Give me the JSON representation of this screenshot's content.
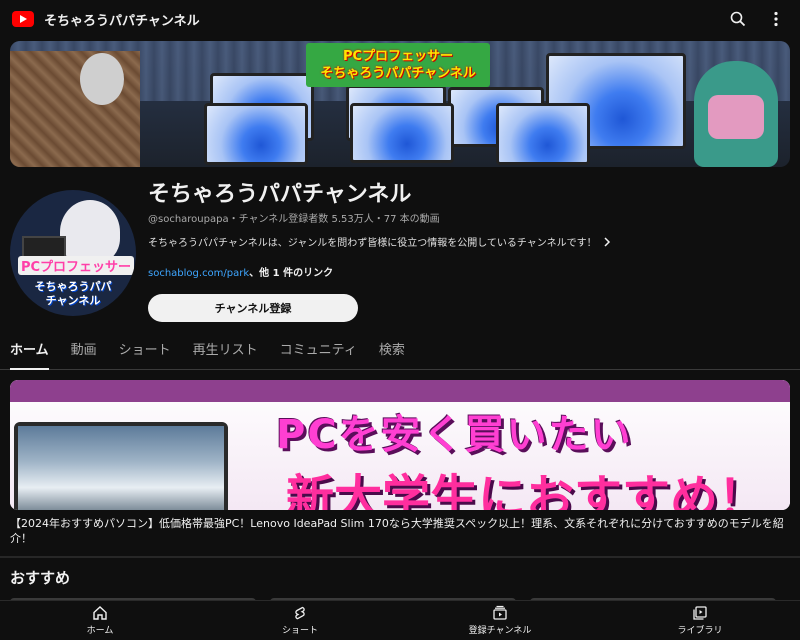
{
  "topbar": {
    "title": "そちゃろうパパチャンネル"
  },
  "banner": {
    "sign_line1": "PCプロフェッサー",
    "sign_line2": "そちゃろうパパチャンネル"
  },
  "avatar": {
    "line1": "PCプロフェッサー",
    "line2": "そちゃろうパパ",
    "line3": "チャンネル"
  },
  "channel": {
    "name": "そちゃろうパパチャンネル",
    "meta": "@socharoupapa・チャンネル登録者数 5.53万人・77 本の動画",
    "description": "そちゃろうパパチャンネルは、ジャンルを問わず皆様に役立つ情報を公開しているチャンネルです！",
    "link": "sochablog.com/park",
    "link_more": "、他 1 件のリンク",
    "subscribe_label": "チャンネル登録"
  },
  "tabs": [
    {
      "label": "ホーム",
      "active": true
    },
    {
      "label": "動画"
    },
    {
      "label": "ショート"
    },
    {
      "label": "再生リスト"
    },
    {
      "label": "コミュニティ"
    },
    {
      "label": "検索"
    }
  ],
  "featured": {
    "thumb_line1": "PCを安く買いたい",
    "thumb_line2": "新大学生におすすめ！",
    "title": "【2024年おすすめパソコン】低価格帯最強PC！Lenovo IdeaPad Slim 170なら大学推奨スペック以上！理系、文系それぞれに分けておすすめのモデルを紹介！"
  },
  "section": {
    "title": "おすすめ"
  },
  "bottom_nav": [
    {
      "label": "ホーム",
      "icon": "home-icon"
    },
    {
      "label": "ショート",
      "icon": "shorts-icon"
    },
    {
      "label": "登録チャンネル",
      "icon": "subscriptions-icon"
    },
    {
      "label": "ライブラリ",
      "icon": "library-icon"
    }
  ],
  "colors": {
    "accent": "#ff0000",
    "link": "#3ea6ff",
    "background": "#0f0f0f"
  }
}
